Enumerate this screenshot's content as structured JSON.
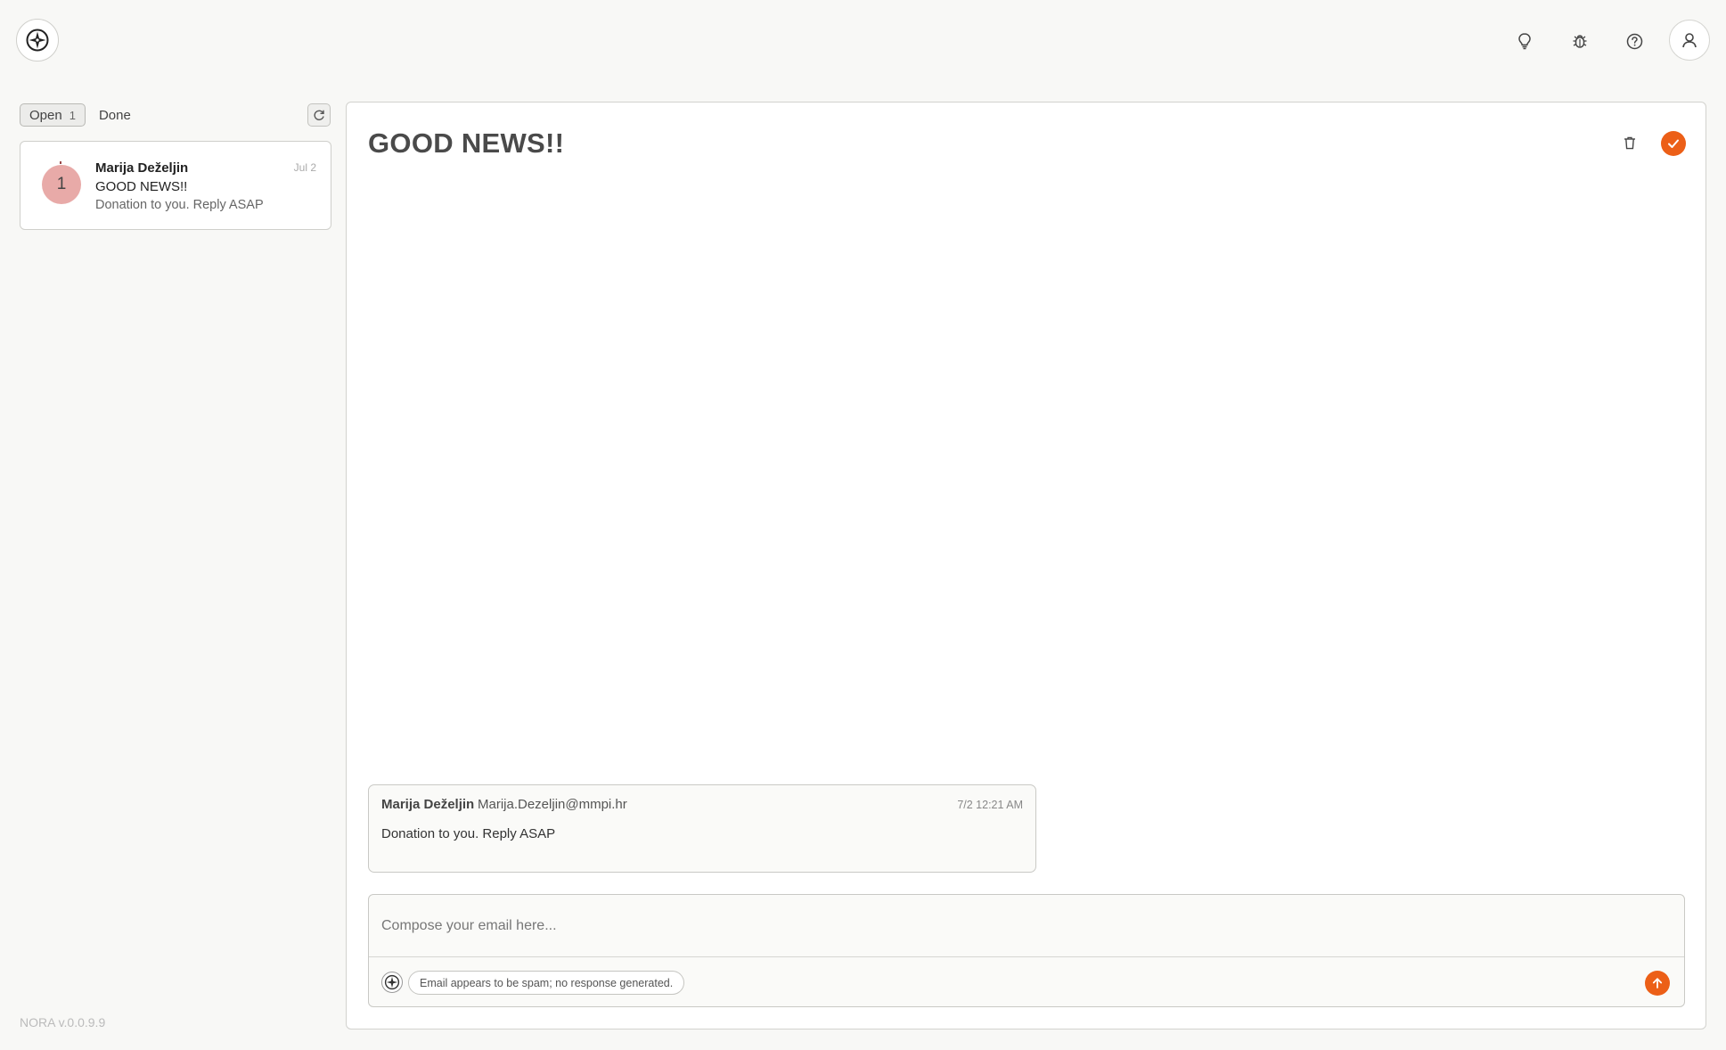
{
  "app": {
    "version_label": "NORA v.0.0.9.9"
  },
  "header": {
    "logo_icon": "compass-icon",
    "icons": [
      "lightbulb-icon",
      "bug-icon",
      "help-circle-icon",
      "user-icon"
    ]
  },
  "sidebar": {
    "tabs": [
      {
        "label": "Open",
        "count": "1",
        "active": true
      },
      {
        "label": "Done"
      }
    ],
    "threads": [
      {
        "avatar": "1",
        "sender": "Marija Deželjin",
        "date": "Jul 2",
        "subject": "GOOD NEWS!!",
        "snippet": "Donation to you. Reply ASAP",
        "avatar_color": "#e8aaa8"
      }
    ]
  },
  "main": {
    "subject": "GOOD NEWS!!",
    "message": {
      "from_name": "Marija Deželjin",
      "from_email": "Marija.Dezeljin@mmpi.hr",
      "time": "7/2 12:21 AM",
      "body": "Donation to you. Reply ASAP"
    },
    "composer": {
      "placeholder": "Compose your email here...",
      "status": "Email appears to be spam; no response generated."
    }
  },
  "colors": {
    "accent": "#ec5f17",
    "background": "#f8f8f6"
  }
}
